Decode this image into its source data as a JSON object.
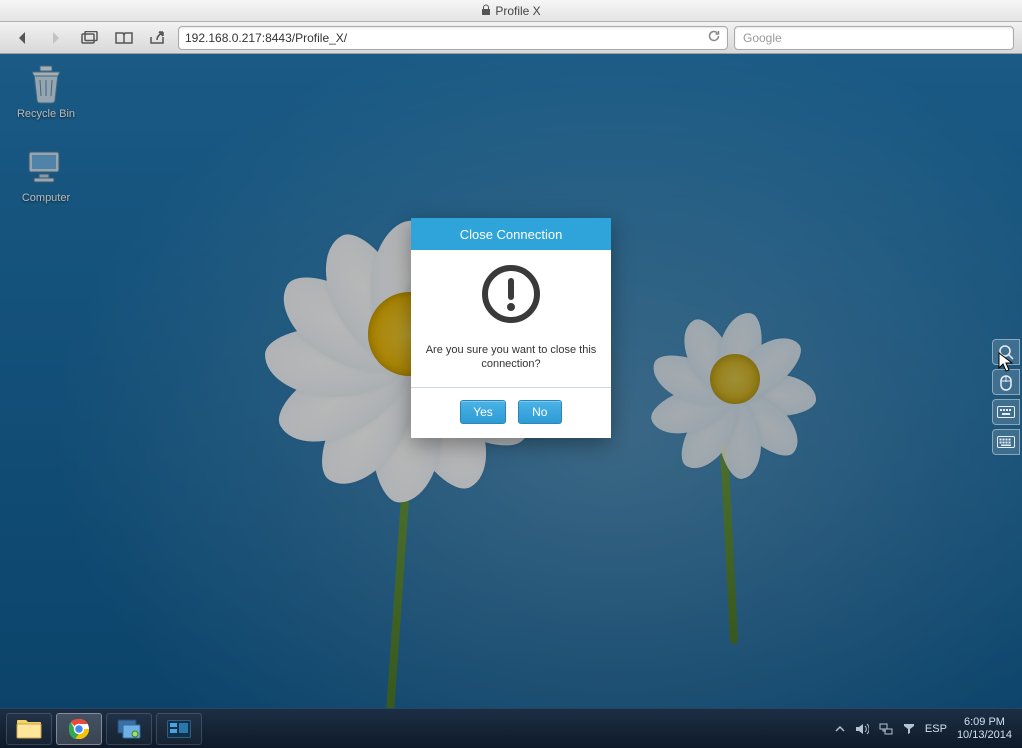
{
  "browser": {
    "page_title": "Profile X",
    "address": "192.168.0.217:8443/Profile_X/",
    "search_placeholder": "Google"
  },
  "desktop": {
    "icons": {
      "recycle_bin_label": "Recycle Bin",
      "computer_label": "Computer"
    }
  },
  "dialog": {
    "title": "Close Connection",
    "message": "Are you sure you want to close this connection?",
    "yes_label": "Yes",
    "no_label": "No"
  },
  "taskbar": {
    "tray": {
      "keyboard_layout": "ESP",
      "time": "6:09 PM",
      "date": "10/13/2014"
    }
  }
}
